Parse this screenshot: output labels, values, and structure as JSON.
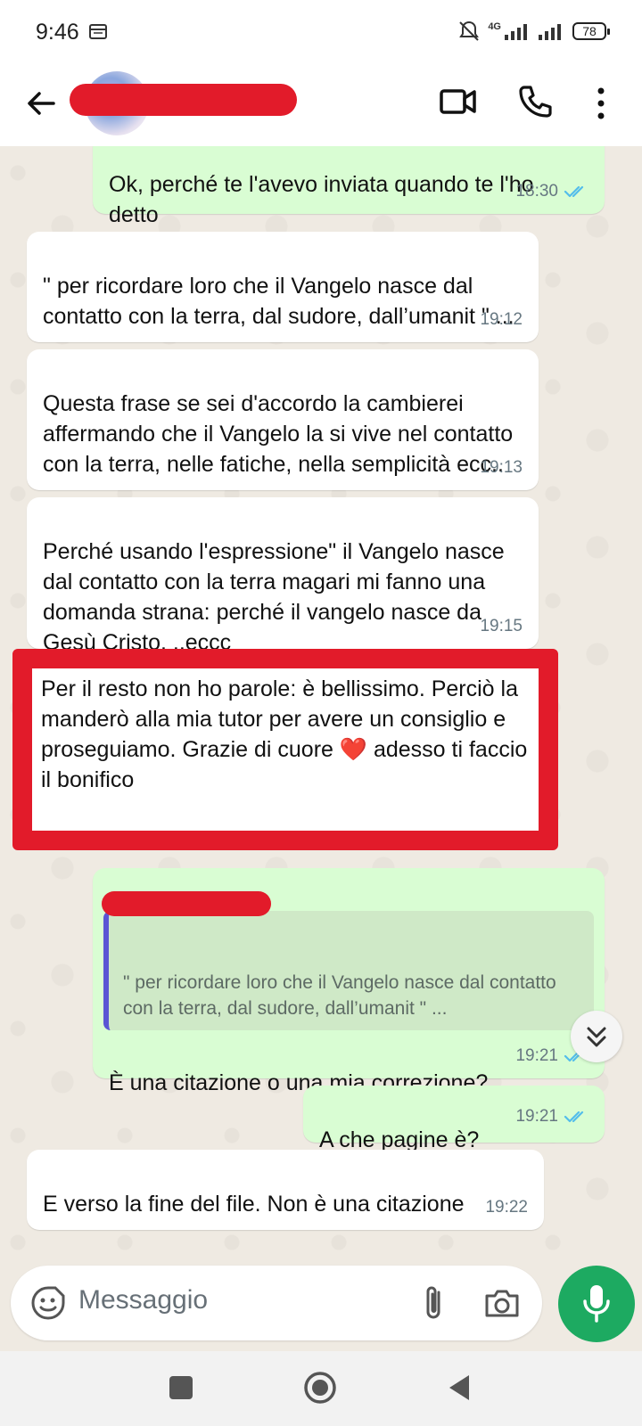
{
  "status_bar": {
    "time": "9:46",
    "network": "4G",
    "battery": "78"
  },
  "header": {
    "contact_name": ""
  },
  "messages": [
    {
      "direction": "out",
      "text": "Ok, perché te l'avevo inviata quando te l'ho detto",
      "time": "18:30",
      "read": true
    },
    {
      "direction": "in",
      "text": "\" per ricordare loro che il Vangelo nasce dal contatto con la terra, dal sudore, dall’umanit \" ...",
      "time": "19:12"
    },
    {
      "direction": "in",
      "text": "Questa frase se sei d'accordo la cambierei affermando che il Vangelo la si vive nel contatto con la terra,  nelle fatiche,  nella semplicità ecc..",
      "time": "19:13"
    },
    {
      "direction": "in",
      "text": "Perché usando l'espressione\" il Vangelo nasce dal contatto con la terra magari mi fanno una domanda strana: perché il vangelo nasce da Gesù  Cristo. ..eccc",
      "time": "19:15"
    },
    {
      "direction": "in",
      "text": "Per il resto non ho parole: è bellissimo. Perciò la manderò alla mia tutor per avere un consiglio e proseguiamo. Grazie di cuore ❤️  adesso ti faccio il bonifico",
      "time": ""
    },
    {
      "direction": "out",
      "quote_text": "\" per ricordare loro che il Vangelo nasce dal contatto con la terra, dal sudore, dall’umanit \" ...",
      "text": "È una citazione o una mia correzione?",
      "time": "19:21",
      "read": true
    },
    {
      "direction": "out",
      "text": "A che pagine è?",
      "time": "19:21",
      "read": true
    },
    {
      "direction": "in",
      "text": "E verso la fine del file. Non è una citazione",
      "time": "19:22"
    }
  ],
  "composer": {
    "placeholder": "Messaggio"
  },
  "colors": {
    "outgoing_bubble": "#d9fdd3",
    "incoming_bubble": "#ffffff",
    "read_ticks": "#53bdeb",
    "mic_button": "#1daa61",
    "redaction": "#e21b2a"
  },
  "icons": [
    "back-arrow-icon",
    "video-call-icon",
    "phone-icon",
    "more-vertical-icon",
    "double-check-icon",
    "chevron-double-down-icon",
    "emoji-icon",
    "paperclip-icon",
    "camera-icon",
    "microphone-icon"
  ]
}
